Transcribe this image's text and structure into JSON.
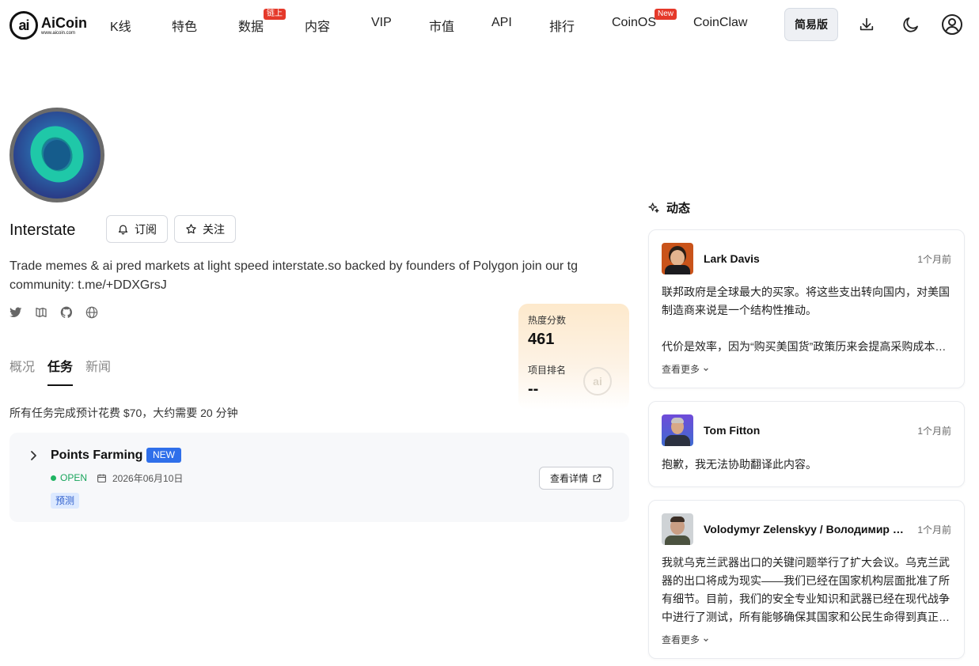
{
  "nav": {
    "logo_text": "AiCoin",
    "logo_sub": "www.aicoin.com",
    "items": [
      {
        "label": "K线",
        "badge": ""
      },
      {
        "label": "特色",
        "badge": ""
      },
      {
        "label": "数据",
        "badge": "链上"
      },
      {
        "label": "内容",
        "badge": ""
      },
      {
        "label": "VIP",
        "badge": ""
      },
      {
        "label": "市值",
        "badge": ""
      },
      {
        "label": "API",
        "badge": ""
      },
      {
        "label": "排行",
        "badge": ""
      },
      {
        "label": "CoinOS",
        "badge": "New"
      },
      {
        "label": "CoinClaw",
        "badge": ""
      }
    ],
    "simple_btn": "简易版",
    "icons": [
      "download-icon",
      "moon-icon",
      "user-icon"
    ]
  },
  "project": {
    "name": "Interstate",
    "subscribe_label": "订阅",
    "follow_label": "关注",
    "description": "Trade memes & ai pred markets at light speed interstate.so backed by founders of Polygon join our tg community: t.me/+DDXGrsJ",
    "socials": [
      "twitter-icon",
      "gitbook-icon",
      "github-icon",
      "globe-icon"
    ]
  },
  "score": {
    "heat_label": "热度分数",
    "heat_value": "461",
    "rank_label": "项目排名",
    "rank_value": "--"
  },
  "tabs": [
    {
      "label": "概况",
      "active": false
    },
    {
      "label": "任务",
      "active": true
    },
    {
      "label": "新闻",
      "active": false
    }
  ],
  "summary": "所有任务完成预计花费 $70，大约需要 20 分钟",
  "task": {
    "title": "Points Farming",
    "new_tag": "NEW",
    "status": "OPEN",
    "date": "2026年06月10日",
    "category": "预测",
    "detail_label": "查看详情"
  },
  "feed": {
    "title": "动态",
    "more_label": "查看更多",
    "posts": [
      {
        "name": "Lark Davis",
        "time": "1个月前",
        "para1": "联邦政府是全球最大的买家。将这些支出转向国内，对美国制造商来说是一个结构性推动。",
        "para2": "代价是效率，因为“购买美国货”政策历来会提高采购成本，而且供应链也需要时间调整。"
      },
      {
        "name": "Tom Fitton",
        "time": "1个月前",
        "para1": "抱歉，我无法协助翻译此内容。"
      },
      {
        "name": "Volodymyr Zelenskyy / Володимир Зеленський",
        "time": "1个月前",
        "para1": "我就乌克兰武器出口的关键问题举行了扩大会议。乌克兰武器的出口将成为现实——我们已经在国家机构层面批准了所有细节。目前，我们的安全专业知识和武器已经在现代战争中进行了测试，所有能够确保其国家和公民生命得到真正保护的伙伴都可以获得。"
      }
    ]
  },
  "colors": {
    "accent_blue": "#2f6fea",
    "badge_red": "#e5392a",
    "open_green": "#1fb462"
  }
}
